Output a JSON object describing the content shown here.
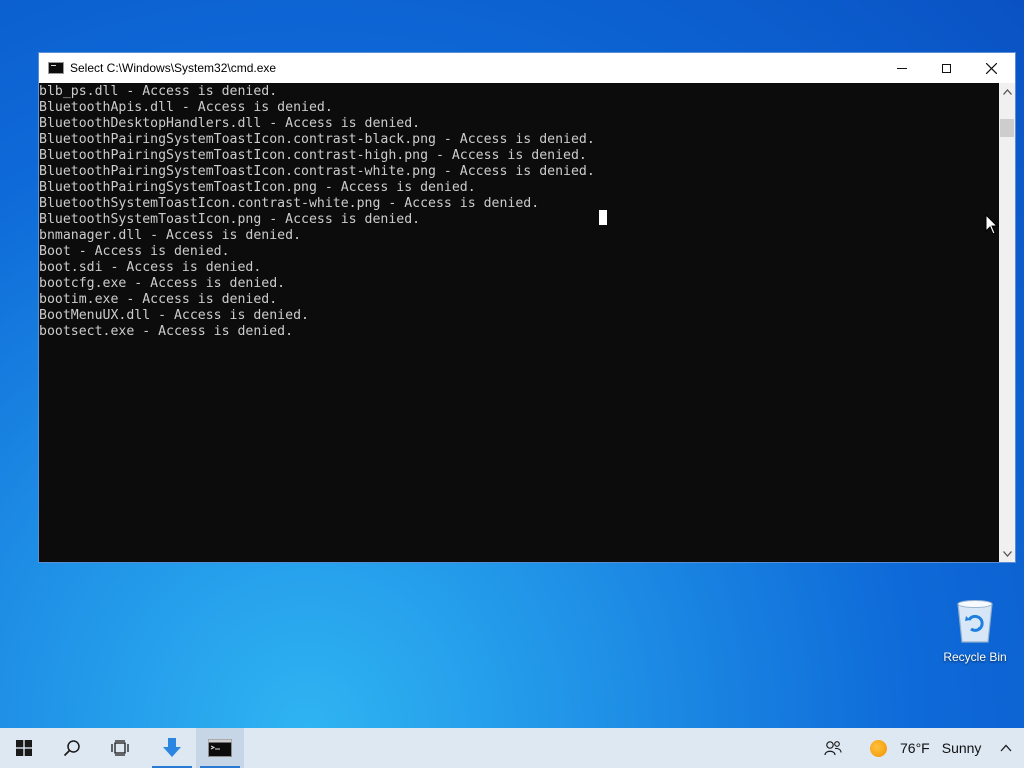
{
  "window": {
    "title": "Select C:\\Windows\\System32\\cmd.exe",
    "icon": "cmd-icon",
    "controls": [
      "minimize-icon",
      "maximize-icon",
      "close-icon"
    ]
  },
  "console": {
    "lines": [
      "blb_ps.dll - Access is denied.",
      "BluetoothApis.dll - Access is denied.",
      "BluetoothDesktopHandlers.dll - Access is denied.",
      "BluetoothPairingSystemToastIcon.contrast-black.png - Access is denied.",
      "BluetoothPairingSystemToastIcon.contrast-high.png - Access is denied.",
      "BluetoothPairingSystemToastIcon.contrast-white.png - Access is denied.",
      "BluetoothPairingSystemToastIcon.png - Access is denied.",
      "BluetoothSystemToastIcon.contrast-white.png - Access is denied.",
      "BluetoothSystemToastIcon.png - Access is denied.",
      "bnmanager.dll - Access is denied.",
      "Boot - Access is denied.",
      "boot.sdi - Access is denied.",
      "bootcfg.exe - Access is denied.",
      "bootim.exe - Access is denied.",
      "BootMenuUX.dll - Access is denied.",
      "bootsect.exe - Access is denied."
    ]
  },
  "desktop": {
    "recycle_bin_label": "Recycle Bin"
  },
  "taskbar": {
    "items": [
      "windows-start-icon",
      "search-icon",
      "task-view-icon",
      "download-app-icon",
      "cmd-app-icon"
    ],
    "weather_temp": "76°F",
    "weather_condition": "Sunny",
    "weather_icon": "sun-icon"
  },
  "colors": {
    "console_bg": "#0c0c0c",
    "console_text": "#cccccc",
    "taskbar_bg": "#dde8f3",
    "accent": "#2a7ad3"
  }
}
